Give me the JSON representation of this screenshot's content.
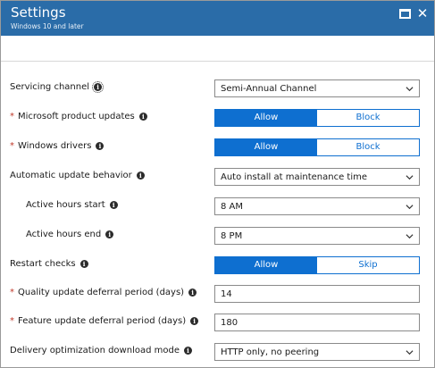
{
  "header": {
    "title": "Settings",
    "subtitle": "Windows 10 and later",
    "maximize_icon": "maximize-icon",
    "close_icon": "close-icon",
    "close_glyph": "✕"
  },
  "info_glyph": "i",
  "fields": {
    "servicing_channel": {
      "label": "Servicing channel",
      "value": "Semi-Annual Channel"
    },
    "microsoft_product_updates": {
      "label": "Microsoft product updates",
      "required_mark": "*",
      "on": "Allow",
      "off": "Block"
    },
    "windows_drivers": {
      "label": "Windows drivers",
      "required_mark": "*",
      "on": "Allow",
      "off": "Block"
    },
    "automatic_update_behavior": {
      "label": "Automatic update behavior",
      "value": "Auto install at maintenance time"
    },
    "active_hours_start": {
      "label": "Active hours start",
      "value": "8 AM"
    },
    "active_hours_end": {
      "label": "Active hours end",
      "value": "8 PM"
    },
    "restart_checks": {
      "label": "Restart checks",
      "on": "Allow",
      "off": "Skip"
    },
    "quality_update_deferral": {
      "label": "Quality update deferral period (days)",
      "required_mark": "*",
      "value": "14"
    },
    "feature_update_deferral": {
      "label": "Feature update deferral period (days)",
      "required_mark": "*",
      "value": "180"
    },
    "delivery_optimization": {
      "label": "Delivery optimization download mode",
      "value": "HTTP only, no peering"
    }
  },
  "colors": {
    "header": "#2a6ca8",
    "accent": "#0e6fd0",
    "required": "#c0392b"
  }
}
